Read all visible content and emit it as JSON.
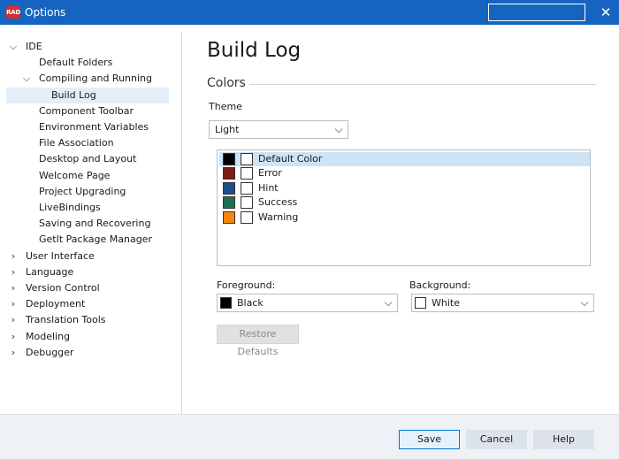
{
  "window": {
    "logo_text": "RAD",
    "title": "Options",
    "close_glyph": "✕"
  },
  "tree": {
    "items": [
      {
        "label": "IDE",
        "chevron": "expanded"
      },
      {
        "label": "Default Folders"
      },
      {
        "label": "Compiling and Running",
        "chevron": "expanded"
      },
      {
        "label": "Build Log",
        "selected": true
      },
      {
        "label": "Component Toolbar"
      },
      {
        "label": "Environment Variables"
      },
      {
        "label": "File Association"
      },
      {
        "label": "Desktop and Layout"
      },
      {
        "label": "Welcome Page"
      },
      {
        "label": "Project Upgrading"
      },
      {
        "label": "LiveBindings"
      },
      {
        "label": "Saving and Recovering"
      },
      {
        "label": "GetIt Package Manager"
      },
      {
        "label": "User Interface",
        "chevron": "collapsed"
      },
      {
        "label": "Language",
        "chevron": "collapsed"
      },
      {
        "label": "Version Control",
        "chevron": "collapsed"
      },
      {
        "label": "Deployment",
        "chevron": "collapsed"
      },
      {
        "label": "Translation Tools",
        "chevron": "collapsed"
      },
      {
        "label": "Modeling",
        "chevron": "collapsed"
      },
      {
        "label": "Debugger",
        "chevron": "collapsed"
      }
    ]
  },
  "page": {
    "title": "Build Log",
    "section": "Colors",
    "theme_label": "Theme",
    "theme_value": "Light",
    "color_items": [
      {
        "label": "Default Color",
        "fg": "#000000",
        "selected": true
      },
      {
        "label": "Error",
        "fg": "#7b1f12"
      },
      {
        "label": "Hint",
        "fg": "#1b4f8c"
      },
      {
        "label": "Success",
        "fg": "#1f7050"
      },
      {
        "label": "Warning",
        "fg": "#f5850c"
      }
    ],
    "foreground_label": "Foreground:",
    "foreground_value": "Black",
    "foreground_color": "#000000",
    "background_label": "Background:",
    "background_value": "White",
    "background_color": "#ffffff",
    "restore_label": "Restore Defaults"
  },
  "footer": {
    "save_label": "Save",
    "cancel_label": "Cancel",
    "help_label": "Help"
  },
  "colors": {
    "titlebar": "#1565c0",
    "selection": "#cce4f7",
    "tree_selection": "#e5eef7",
    "footer_bg": "#eef2f7"
  }
}
